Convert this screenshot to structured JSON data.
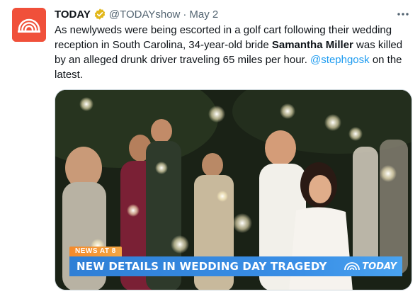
{
  "tweet": {
    "author_name": "TODAY",
    "verified_icon": "verified-badge-icon",
    "handle": "@TODAYshow",
    "separator": "·",
    "date": "May 2",
    "more_icon": "more-options-icon",
    "body": {
      "part1": "As newlyweds were being escorted in a golf cart following their wedding reception in South Carolina, 34-year-old bride ",
      "bold_name": "Samantha Miller",
      "part2": " was killed by an alleged drunk driver traveling 65 miles per hour. ",
      "mention": "@stephgosk",
      "part3": " on the latest."
    }
  },
  "media": {
    "chyron_tag": "NEWS AT 8",
    "chyron_headline": "NEW DETAILS IN WEDDING DAY TRAGEDY",
    "chyron_logo": "TODAY"
  },
  "colors": {
    "brand": "#f0503a",
    "mention": "#1d9bf0",
    "chyron_blue": "#2f7fd6",
    "chyron_orange": "#f58a2c",
    "verified_gold": "#e2b719"
  }
}
